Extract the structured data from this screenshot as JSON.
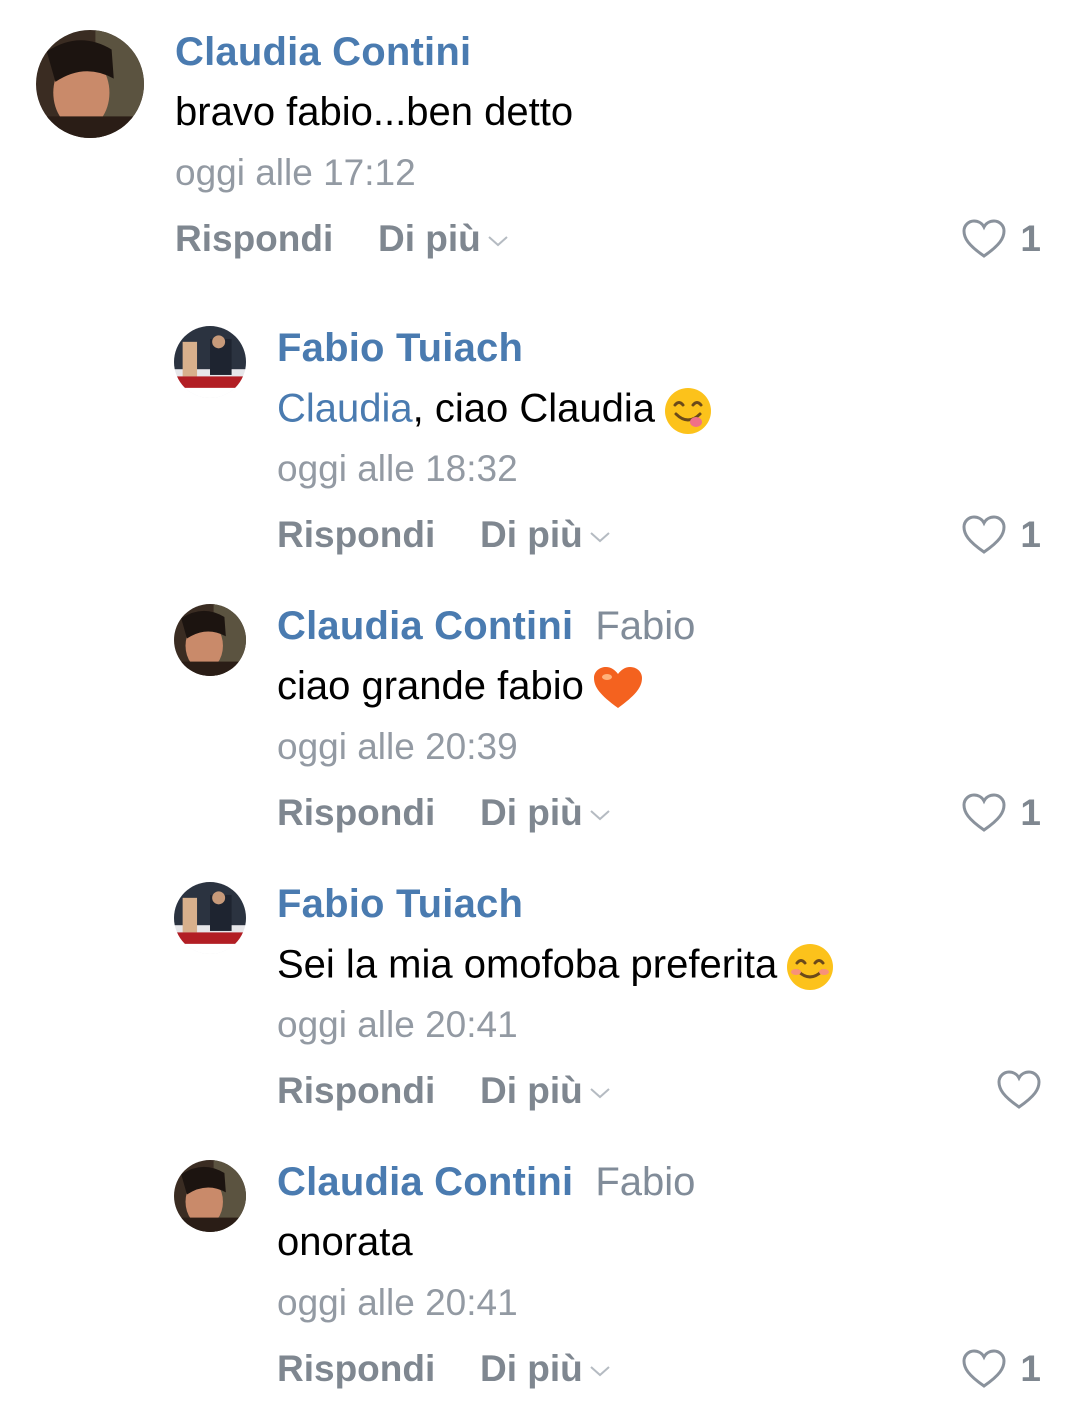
{
  "comments": [
    {
      "author": "Claudia Contini",
      "reply_to": "",
      "mention": "",
      "text": "bravo fabio...ben detto",
      "emoji": "",
      "time": "oggi alle 17:12",
      "reply_label": "Rispondi",
      "more_label": "Di più",
      "likes": "1"
    },
    {
      "author": "Fabio Tuiach",
      "reply_to": "",
      "mention": "Claudia",
      "text": ", ciao Claudia",
      "emoji": "yum-face-emoji",
      "time": "oggi alle 18:32",
      "reply_label": "Rispondi",
      "more_label": "Di più",
      "likes": "1"
    },
    {
      "author": "Claudia Contini",
      "reply_to": "Fabio",
      "mention": "",
      "text": "ciao grande fabio",
      "emoji": "orange-heart-emoji",
      "time": "oggi alle 20:39",
      "reply_label": "Rispondi",
      "more_label": "Di più",
      "likes": "1"
    },
    {
      "author": "Fabio Tuiach",
      "reply_to": "",
      "mention": "",
      "text": "Sei la mia omofoba preferita",
      "emoji": "smiling-face-emoji",
      "time": "oggi alle 20:41",
      "reply_label": "Rispondi",
      "more_label": "Di più",
      "likes": ""
    },
    {
      "author": "Claudia Contini",
      "reply_to": "Fabio",
      "mention": "",
      "text": "onorata",
      "emoji": "",
      "time": "oggi alle 20:41",
      "reply_label": "Rispondi",
      "more_label": "Di più",
      "likes": "1"
    }
  ],
  "colors": {
    "author": "#4a7bb0",
    "meta": "#939aa3",
    "action": "#7f8790"
  }
}
